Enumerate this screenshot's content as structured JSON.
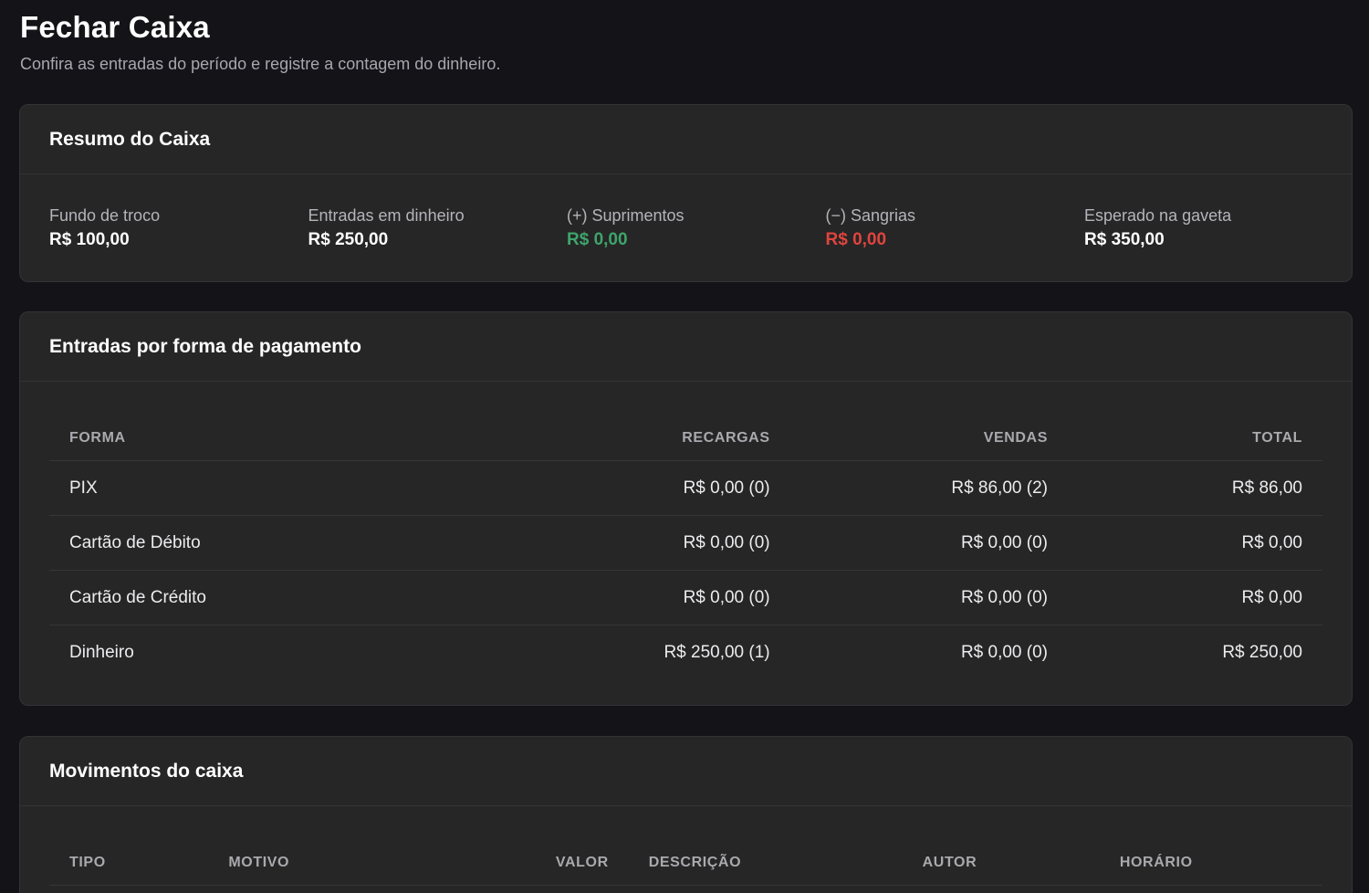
{
  "page": {
    "title": "Fechar Caixa",
    "subtitle": "Confira as entradas do período e registre a contagem do dinheiro."
  },
  "summary": {
    "title": "Resumo do Caixa",
    "items": [
      {
        "label": "Fundo de troco",
        "value": "R$ 100,00"
      },
      {
        "label": "Entradas em dinheiro",
        "value": "R$ 250,00"
      },
      {
        "label": "(+) Suprimentos",
        "value": "R$ 0,00"
      },
      {
        "label": "(−) Sangrias",
        "value": "R$ 0,00"
      },
      {
        "label": "Esperado na gaveta",
        "value": "R$ 350,00"
      }
    ],
    "colors": {
      "positive": "#3ea56b",
      "negative": "#e0443e"
    }
  },
  "payments": {
    "title": "Entradas por forma de pagamento",
    "columns": [
      "FORMA",
      "RECARGAS",
      "VENDAS",
      "TOTAL"
    ],
    "rows": [
      {
        "forma": "PIX",
        "recargas": "R$ 0,00 (0)",
        "vendas": "R$ 86,00 (2)",
        "total": "R$ 86,00"
      },
      {
        "forma": "Cartão de Débito",
        "recargas": "R$ 0,00 (0)",
        "vendas": "R$ 0,00 (0)",
        "total": "R$ 0,00"
      },
      {
        "forma": "Cartão de Crédito",
        "recargas": "R$ 0,00 (0)",
        "vendas": "R$ 0,00 (0)",
        "total": "R$ 0,00"
      },
      {
        "forma": "Dinheiro",
        "recargas": "R$ 250,00 (1)",
        "vendas": "R$ 0,00 (0)",
        "total": "R$ 250,00"
      }
    ]
  },
  "movements": {
    "title": "Movimentos do caixa",
    "columns": [
      "TIPO",
      "MOTIVO",
      "VALOR",
      "DESCRIÇÃO",
      "AUTOR",
      "HORÁRIO"
    ]
  }
}
